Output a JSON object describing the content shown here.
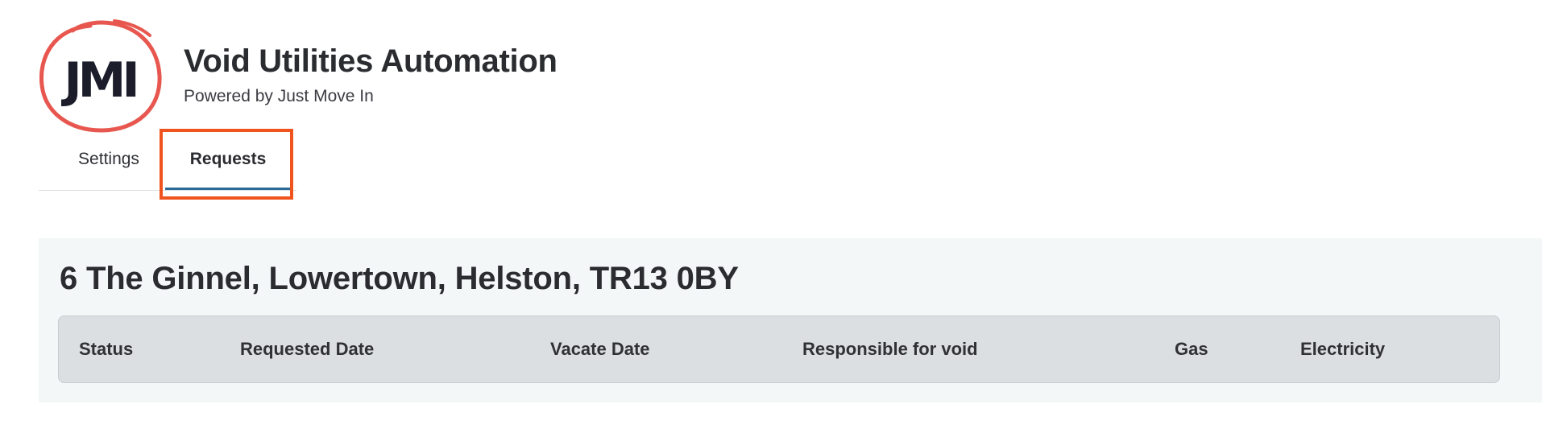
{
  "header": {
    "logo_text": "JMI",
    "title": "Void Utilities Automation",
    "subtitle": "Powered by Just Move In"
  },
  "tabs": [
    {
      "label": "Settings",
      "active": false
    },
    {
      "label": "Requests",
      "active": true
    }
  ],
  "property": {
    "address": "6 The Ginnel, Lowertown, Helston, TR13 0BY",
    "table": {
      "columns": [
        "Status",
        "Requested Date",
        "Vacate Date",
        "Responsible for void",
        "Gas",
        "Electricity"
      ],
      "rows": []
    }
  },
  "colors": {
    "logo_ring": "#e8574f",
    "logo_text": "#1b1d2b",
    "active_tab_underline": "#2c6a96",
    "highlight_box": "#f0541e",
    "panel_background": "#f4f7f7",
    "table_header_background": "#dcdfe2"
  }
}
